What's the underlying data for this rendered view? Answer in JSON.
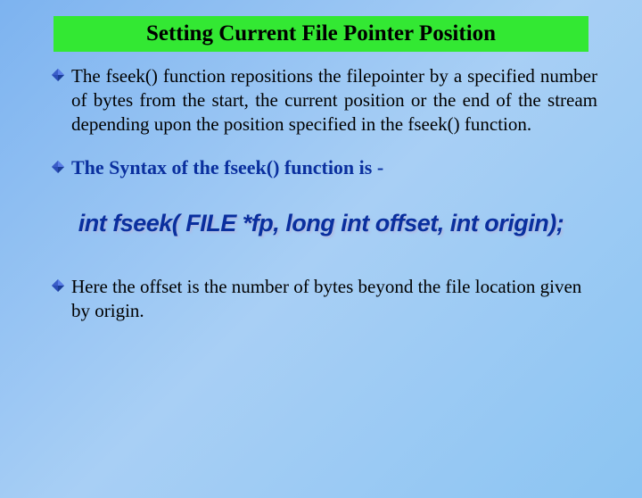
{
  "title": "Setting Current File Pointer Position",
  "bullets": {
    "b1": "The fseek() function repositions the filepointer by a specified number of bytes from the start, the current position or the end of the stream  depending upon the position specified in the fseek() function.",
    "b2": "The Syntax of the fseek() function is -",
    "syntax": "int fseek( FILE *fp, long int offset, int origin);",
    "b3": "Here the offset is the number of bytes beyond the file location given by origin."
  }
}
